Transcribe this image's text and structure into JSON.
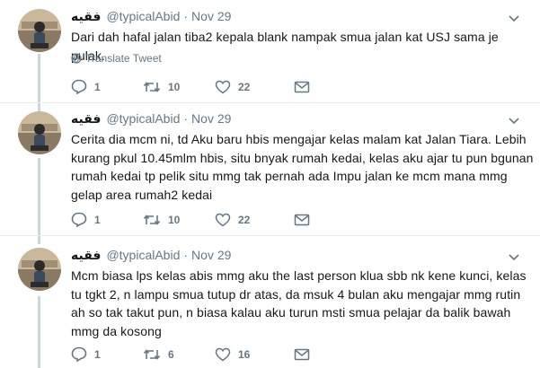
{
  "tweets": [
    {
      "name": "فقيه",
      "handle": "@typicalAbid",
      "time": "Nov 29",
      "text": "Dari dah hafal jalan tiba2 kepala blank nampak smua jalan kat USJ sama je pulak.",
      "translate": "Translate Tweet",
      "replies": "1",
      "retweets": "10",
      "likes": "22"
    },
    {
      "name": "فقيه",
      "handle": "@typicalAbid",
      "time": "Nov 29",
      "text": "Cerita dia mcm ni, td Aku baru hbis mengajar kelas malam kat Jalan Tiara.  Lebih kurang pkul 10.45mlm hbis, situ bnyak rumah kedai, kelas aku ajar tu pun bgunan rumah kedai tp pelik situ mmg tak pernah ada Impu jalan ke mcm mana mmg gelap area rumah2 kedai",
      "replies": "1",
      "retweets": "10",
      "likes": "22"
    },
    {
      "name": "فقيه",
      "handle": "@typicalAbid",
      "time": "Nov 29",
      "text": "Mcm biasa lps kelas abis mmg aku the last person klua sbb nk kene kunci, kelas tu tgkt 2, n lampu smua tutup dr atas, da msuk 4 bulan aku mengajar mmg rutin ah so tak takut pun, n biasa kalau aku turun msti smua pelajar da balik bawah mmg da kosong",
      "replies": "1",
      "retweets": "6",
      "likes": "16"
    }
  ],
  "colors": {
    "meta": "#657786",
    "thread": "#ccd6dd",
    "divider": "#e6ecf0"
  }
}
